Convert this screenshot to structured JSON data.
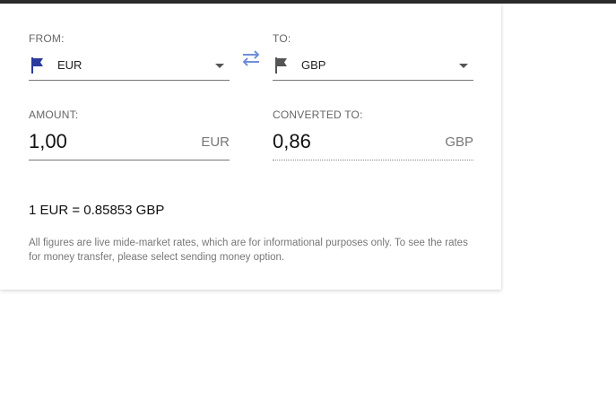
{
  "from": {
    "label": "FROM:",
    "currency": "EUR",
    "flag_icon": "flag-icon",
    "flag_color": "#2a3a9e"
  },
  "to": {
    "label": "TO:",
    "currency": "GBP",
    "flag_icon": "flag-icon",
    "flag_color": "#555555"
  },
  "swap_icon": "swap-arrows-icon",
  "swap_color": "#6f8fd8",
  "amount": {
    "label": "AMOUNT:",
    "value": "1,00",
    "unit": "EUR"
  },
  "converted": {
    "label": "CONVERTED TO:",
    "value": "0,86",
    "unit": "GBP"
  },
  "rate_text": "1 EUR = 0.85853 GBP",
  "disclaimer": "All figures are live mide-market rates, which are for informational purposes only. To see the rates for money transfer, please select sending money option."
}
